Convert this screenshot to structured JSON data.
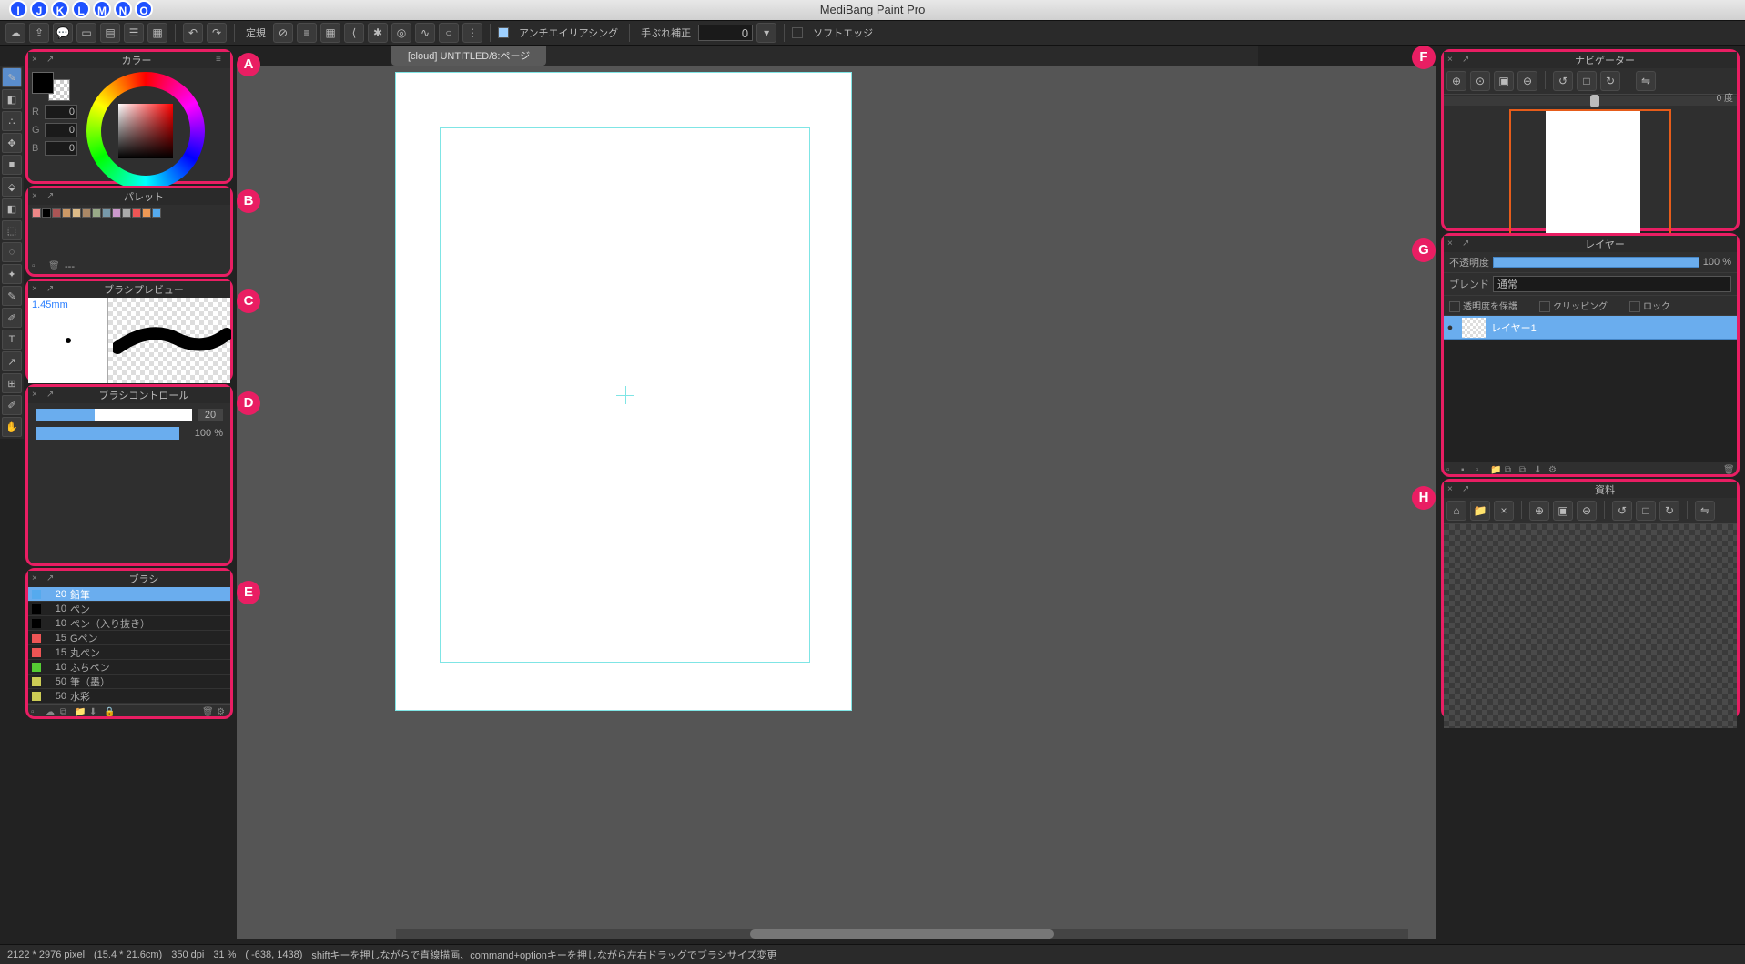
{
  "app": {
    "title": "MediBang Paint Pro"
  },
  "menu_badges": [
    "I",
    "J",
    "K",
    "L",
    "M",
    "N",
    "O"
  ],
  "toolbar": {
    "ruler_label": "定規",
    "antialias_check": true,
    "antialias_label": "アンチエイリアシング",
    "shake_label": "手ぶれ補正",
    "shake_value": "0",
    "softedge_check": false,
    "softedge_label": "ソフトエッジ"
  },
  "document": {
    "tab_title": "[cloud] UNTITLED/8:ページ"
  },
  "left_tools": [
    "brush",
    "eraser",
    "dot",
    "move",
    "fill",
    "rect",
    "bucket",
    "gradient",
    "select-rect",
    "select-lasso",
    "wand",
    "pen",
    "text",
    "divide",
    "eyedrop",
    "hand"
  ],
  "panels": {
    "color": {
      "title": "カラー",
      "R": "0",
      "G": "0",
      "B": "0"
    },
    "palette": {
      "title": "パレット",
      "info": "---",
      "swatches": [
        "#e88",
        "#000",
        "#a55",
        "#c96",
        "#db8",
        "#a86",
        "#9a8",
        "#79a",
        "#c9c",
        "#aaa",
        "#e55",
        "#e95",
        "#5ae"
      ]
    },
    "brush_preview": {
      "title": "ブラシプレビュー",
      "size_label": "1.45mm"
    },
    "brush_control": {
      "title": "ブラシコントロール",
      "size_val": "20",
      "opacity_val": "100 %"
    },
    "brush_list": {
      "title": "ブラシ",
      "items": [
        {
          "color": "#5ae",
          "size": "20",
          "name": "鉛筆",
          "active": true
        },
        {
          "color": "#000",
          "size": "10",
          "name": "ペン"
        },
        {
          "color": "#000",
          "size": "10",
          "name": "ペン（入り抜き）"
        },
        {
          "color": "#e55",
          "size": "15",
          "name": "Gペン"
        },
        {
          "color": "#e55",
          "size": "15",
          "name": "丸ペン"
        },
        {
          "color": "#5c3",
          "size": "10",
          "name": "ふちペン"
        },
        {
          "color": "#cc5",
          "size": "50",
          "name": "筆（墨）"
        },
        {
          "color": "#cc5",
          "size": "50",
          "name": "水彩"
        }
      ]
    },
    "navigator": {
      "title": "ナビゲーター",
      "degree": "0 度"
    },
    "layer": {
      "title": "レイヤー",
      "opacity_label": "不透明度",
      "opacity_val": "100 %",
      "blend_label": "ブレンド",
      "blend_val": "通常",
      "protect_alpha": "透明度を保護",
      "clipping": "クリッピング",
      "lock": "ロック",
      "layer1_name": "レイヤー1"
    },
    "reference": {
      "title": "資料"
    }
  },
  "letter_labels": {
    "A": "A",
    "B": "B",
    "C": "C",
    "D": "D",
    "E": "E",
    "F": "F",
    "G": "G",
    "H": "H"
  },
  "status": {
    "dims": "2122 * 2976 pixel",
    "cm": "(15.4 * 21.6cm)",
    "dpi": "350 dpi",
    "zoom": "31 %",
    "coords": "( -638, 1438)",
    "hint": "shiftキーを押しながらで直線描画、command+optionキーを押しながら左右ドラッグでブラシサイズ変更"
  }
}
